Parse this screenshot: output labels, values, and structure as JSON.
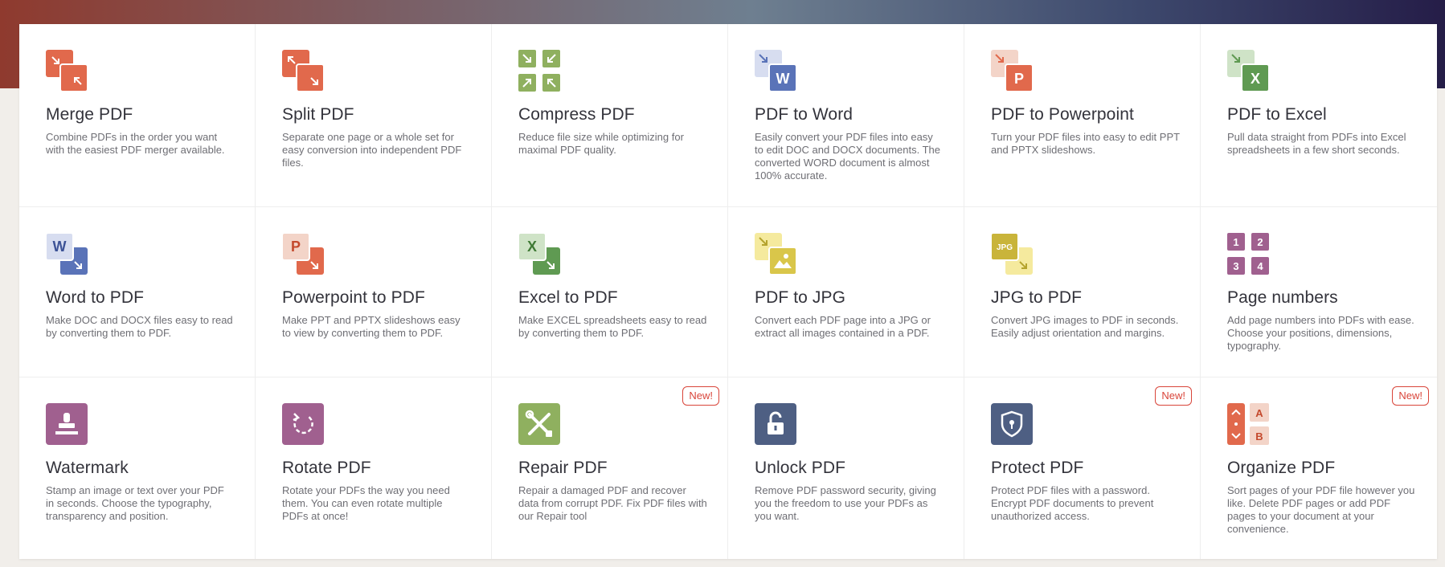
{
  "colors": {
    "merge": "#e1694c",
    "split": "#e1694c",
    "compress": "#8fb05f",
    "word": "#5a73b8",
    "powerpoint": "#e1694c",
    "excel": "#5f9a52",
    "jpg": "#d9c64a",
    "pagenumbers": "#a0608f",
    "watermark": "#a0608f",
    "rotate": "#a0608f",
    "repair": "#8fb05f",
    "unlock": "#4e5f83",
    "protect": "#4e5f83",
    "organize": "#e1694c",
    "badge": "#d9453a"
  },
  "tools": [
    {
      "icon": "merge-pdf-icon",
      "title": "Merge PDF",
      "desc": "Combine PDFs in the order you want with the easiest PDF merger available.",
      "badge": ""
    },
    {
      "icon": "split-pdf-icon",
      "title": "Split PDF",
      "desc": "Separate one page or a whole set for easy conversion into independent PDF files.",
      "badge": ""
    },
    {
      "icon": "compress-pdf-icon",
      "title": "Compress PDF",
      "desc": "Reduce file size while optimizing for maximal PDF quality.",
      "badge": ""
    },
    {
      "icon": "pdf-to-word-icon",
      "title": "PDF to Word",
      "desc": "Easily convert your PDF files into easy to edit DOC and DOCX documents. The converted WORD document is almost 100% accurate.",
      "badge": ""
    },
    {
      "icon": "pdf-to-powerpoint-icon",
      "title": "PDF to Powerpoint",
      "desc": "Turn your PDF files into easy to edit PPT and PPTX slideshows.",
      "badge": ""
    },
    {
      "icon": "pdf-to-excel-icon",
      "title": "PDF to Excel",
      "desc": "Pull data straight from PDFs into Excel spreadsheets in a few short seconds.",
      "badge": ""
    },
    {
      "icon": "word-to-pdf-icon",
      "title": "Word to PDF",
      "desc": "Make DOC and DOCX files easy to read by converting them to PDF.",
      "badge": ""
    },
    {
      "icon": "powerpoint-to-pdf-icon",
      "title": "Powerpoint to PDF",
      "desc": "Make PPT and PPTX slideshows easy to view by converting them to PDF.",
      "badge": ""
    },
    {
      "icon": "excel-to-pdf-icon",
      "title": "Excel to PDF",
      "desc": "Make EXCEL spreadsheets easy to read by converting them to PDF.",
      "badge": ""
    },
    {
      "icon": "pdf-to-jpg-icon",
      "title": "PDF to JPG",
      "desc": "Convert each PDF page into a JPG or extract all images contained in a PDF.",
      "badge": ""
    },
    {
      "icon": "jpg-to-pdf-icon",
      "title": "JPG to PDF",
      "desc": "Convert JPG images to PDF in seconds. Easily adjust orientation and margins.",
      "badge": ""
    },
    {
      "icon": "page-numbers-icon",
      "title": "Page numbers",
      "desc": "Add page numbers into PDFs with ease. Choose your positions, dimensions, typography.",
      "badge": ""
    },
    {
      "icon": "watermark-icon",
      "title": "Watermark",
      "desc": "Stamp an image or text over your PDF in seconds. Choose the typography, transparency and position.",
      "badge": ""
    },
    {
      "icon": "rotate-pdf-icon",
      "title": "Rotate PDF",
      "desc": "Rotate your PDFs the way you need them. You can even rotate multiple PDFs at once!",
      "badge": ""
    },
    {
      "icon": "repair-pdf-icon",
      "title": "Repair PDF",
      "desc": "Repair a damaged PDF and recover data from corrupt PDF. Fix PDF files with our Repair tool",
      "badge": "New!"
    },
    {
      "icon": "unlock-pdf-icon",
      "title": "Unlock PDF",
      "desc": "Remove PDF password security, giving you the freedom to use your PDFs as you want.",
      "badge": ""
    },
    {
      "icon": "protect-pdf-icon",
      "title": "Protect PDF",
      "desc": "Protect PDF files with a password. Encrypt PDF documents to prevent unauthorized access.",
      "badge": "New!"
    },
    {
      "icon": "organize-pdf-icon",
      "title": "Organize PDF",
      "desc": "Sort pages of your PDF file however you like. Delete PDF pages or add PDF pages to your document at your convenience.",
      "badge": "New!"
    }
  ],
  "icon_labels": {
    "word": "W",
    "powerpoint": "P",
    "excel": "X",
    "jpg": "JPG",
    "page_numbers": [
      "1",
      "2",
      "3",
      "4"
    ],
    "organize_a": "A",
    "organize_b": "B"
  }
}
